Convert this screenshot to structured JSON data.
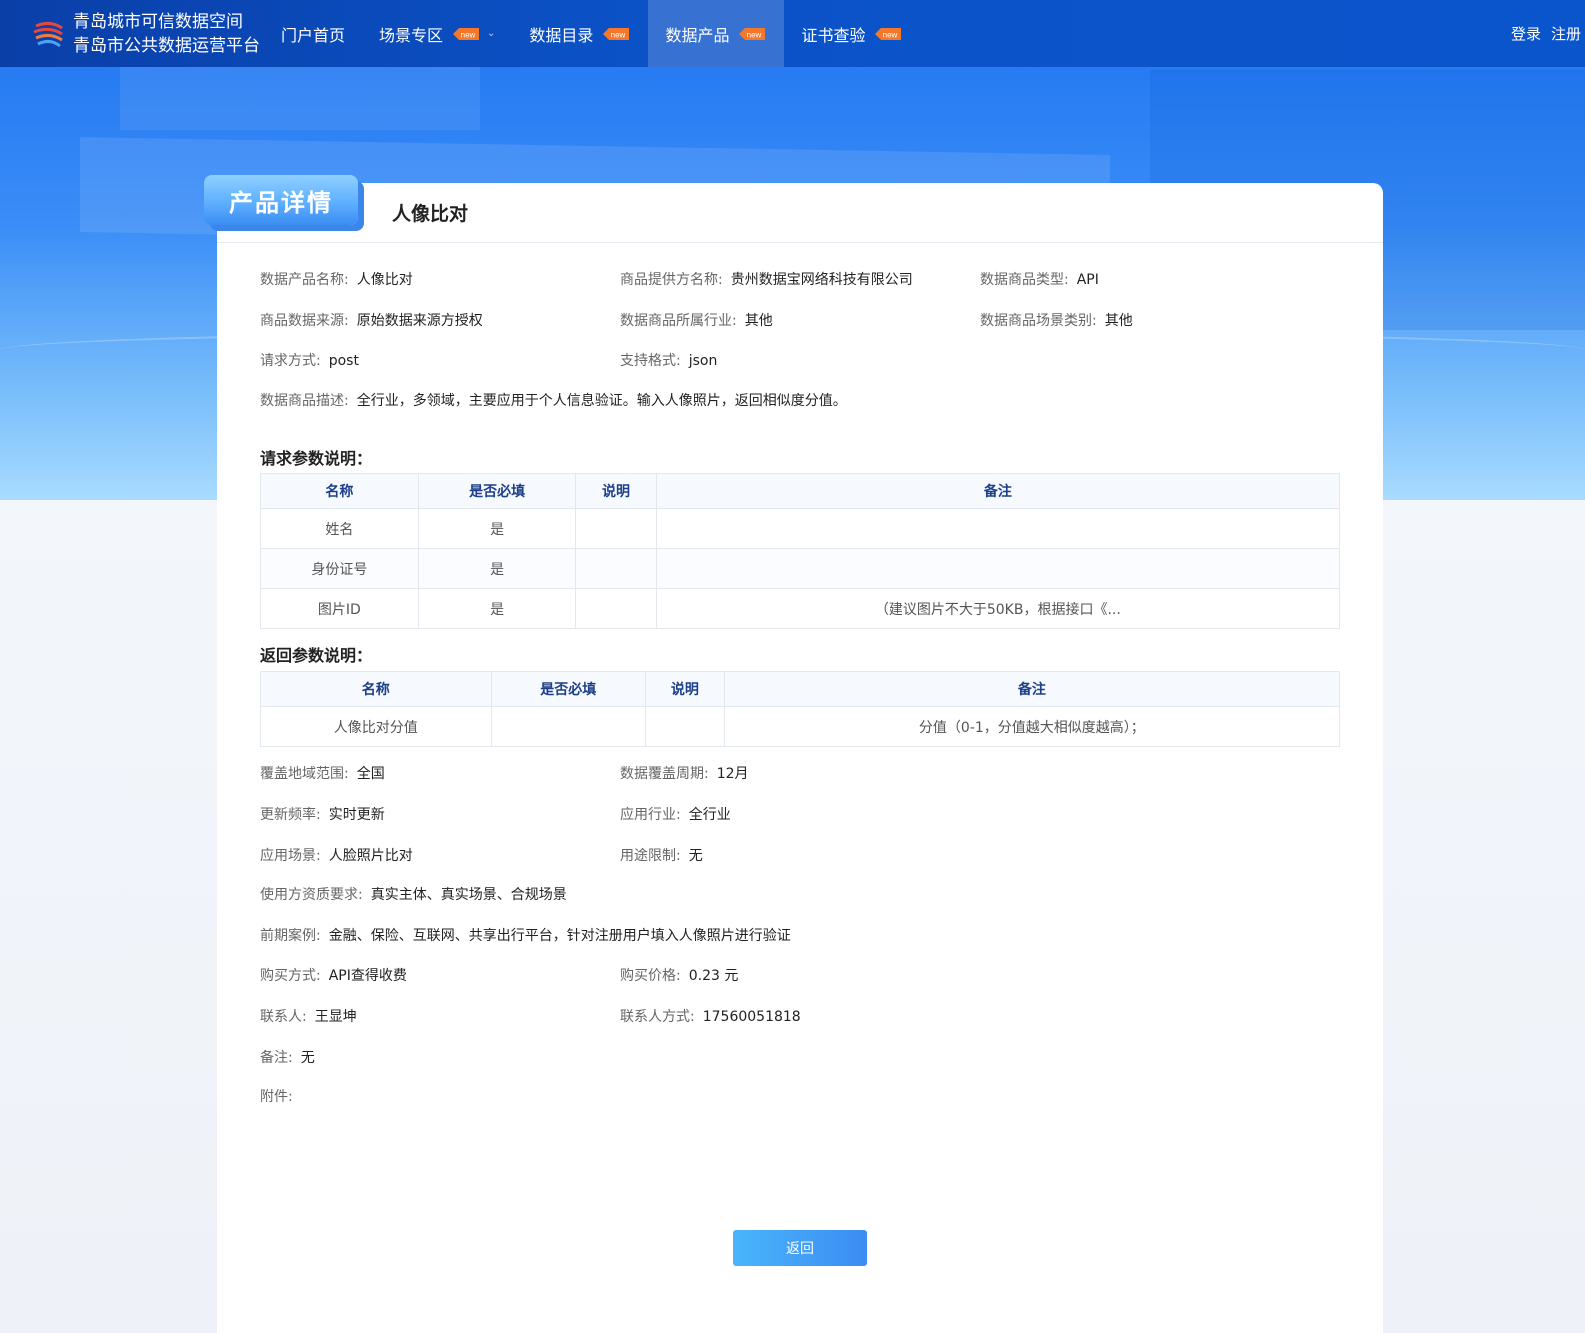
{
  "header": {
    "brand_line1": "青岛城市可信数据空间",
    "brand_line2": "青岛市公共数据运营平台",
    "menu": [
      {
        "label": "门户首页"
      },
      {
        "label": "场景专区"
      },
      {
        "label": "数据目录"
      },
      {
        "label": "数据产品"
      },
      {
        "label": "证书查验"
      }
    ],
    "badge_text": "new",
    "login": "登录",
    "register": "注册"
  },
  "card": {
    "tag": "产品详情",
    "title": "人像比对"
  },
  "fields": {
    "name_label": "数据产品名称:",
    "name_value": "人像比对",
    "provider_label": "商品提供方名称:",
    "provider_value": "贵州数据宝网络科技有限公司",
    "type_label": "数据商品类型:",
    "type_value": "API",
    "source_label": "商品数据来源:",
    "source_value": "原始数据来源方授权",
    "industry_label": "数据商品所属行业:",
    "industry_value": "其他",
    "scene_label": "数据商品场景类别:",
    "scene_value": "其他",
    "method_label": "请求方式:",
    "method_value": "post",
    "format_label": "支持格式:",
    "format_value": "json",
    "desc_label": "数据商品描述:",
    "desc_value": "全行业，多领域，主要应用于个人信息验证。输入人像照片，返回相似度分值。"
  },
  "request": {
    "title": "请求参数说明：",
    "headers": [
      "名称",
      "是否必填",
      "说明",
      "备注"
    ],
    "rows": [
      [
        "姓名",
        "是",
        "",
        ""
      ],
      [
        "身份证号",
        "是",
        "",
        ""
      ],
      [
        "图片ID",
        "是",
        "",
        "（建议图片不大于50KB，根据接口《..."
      ]
    ]
  },
  "response": {
    "title": "返回参数说明：",
    "headers": [
      "名称",
      "是否必填",
      "说明",
      "备注"
    ],
    "rows": [
      [
        "人像比对分值",
        "",
        "",
        "分值（0-1，分值越大相似度越高）；"
      ]
    ]
  },
  "details": {
    "area_label": "覆盖地域范围:",
    "area_value": "全国",
    "period_label": "数据覆盖周期:",
    "period_value": "12月",
    "freq_label": "更新频率:",
    "freq_value": "实时更新",
    "app_industry_label": "应用行业:",
    "app_industry_value": "全行业",
    "app_scene_label": "应用场景:",
    "app_scene_value": "人脸照片比对",
    "limit_label": "用途限制:",
    "limit_value": "无",
    "qual_label": "使用方资质要求:",
    "qual_value": "真实主体、真实场景、合规场景",
    "case_label": "前期案例:",
    "case_value": "金融、保险、互联网、共享出行平台，针对注册用户填入人像照片进行验证",
    "buy_label": "购买方式:",
    "buy_value": "API查得收费",
    "price_label": "购买价格:",
    "price_value": "0.23 元",
    "contact_label": "联系人:",
    "contact_value": "王显坤",
    "phone_label": "联系人方式:",
    "phone_value": "17560051818",
    "note_label": "备注:",
    "note_value": "无",
    "attach_label": "附件:"
  },
  "back_label": "返回"
}
